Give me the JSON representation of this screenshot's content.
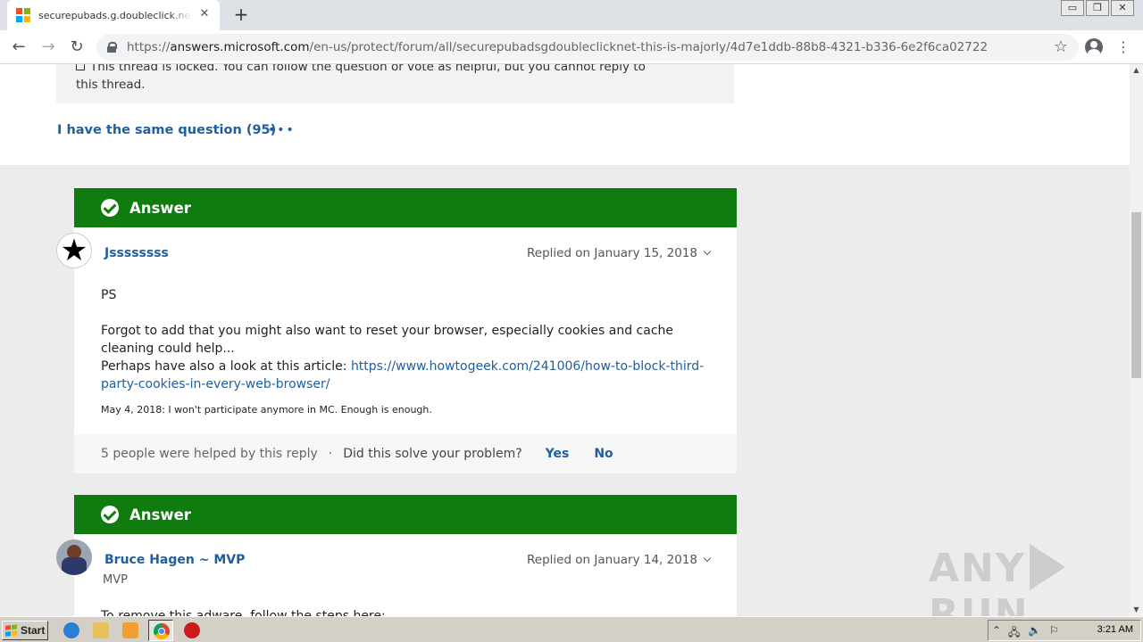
{
  "browser": {
    "tab_title": "securepubads.g.doubleclick.net - this is majorly",
    "url_scheme": "https://",
    "url_host": "answers.microsoft.com",
    "url_path": "/en-us/protect/forum/all/securepubadsgdoubleclicknet-this-is-majorly/4d7e1ddb-88b8-4321-b336-6e2f6ca02722",
    "icons": {
      "back": "←",
      "forward": "→",
      "reload": "↻",
      "star": "☆",
      "menu": "⋮",
      "close": "✕",
      "new_tab": "+",
      "minimize": "▭",
      "restore": "❐",
      "win_close": "✕"
    },
    "favicon_colors": [
      "#f25022",
      "#7fba00",
      "#00a4ef",
      "#ffb900"
    ]
  },
  "thread": {
    "locked_notice": "This thread is locked. You can follow the question or vote as helpful, but you cannot reply to this thread.",
    "same_question": "I have the same question (95)",
    "more": "•••"
  },
  "answers": [
    {
      "header": "Answer",
      "username": "Jssssssss",
      "replied": "Replied on January 15, 2018",
      "paragraphs": [
        "PS",
        "Forgot to add that you might also want to reset your browser, especially cookies and cache cleaning could help...",
        "Perhaps have also a look at this article: "
      ],
      "link": "https://www.howtogeek.com/241006/how-to-block-third-party-cookies-in-every-web-browser/",
      "signature": "May 4, 2018: I won't participate anymore in MC. Enough is enough.",
      "helped": "5 people were helped by this reply",
      "separator": "·",
      "solve_question": "Did this solve your problem?",
      "yes": "Yes",
      "no": "No"
    },
    {
      "header": "Answer",
      "username": "Bruce Hagen ~ MVP",
      "role": "MVP",
      "replied": "Replied on January 14, 2018",
      "first_line": "To remove this adware, follow the steps here:"
    }
  ],
  "watermark": {
    "left": "ANY",
    "right": "RUN"
  },
  "taskbar": {
    "start_label": "Start",
    "clock": "3:21 AM",
    "tray_icons": [
      "⌃",
      "🖧",
      "🔈",
      "⚐"
    ]
  },
  "colors": {
    "answer_green": "#107c10",
    "link_blue": "#1e5fa0"
  }
}
